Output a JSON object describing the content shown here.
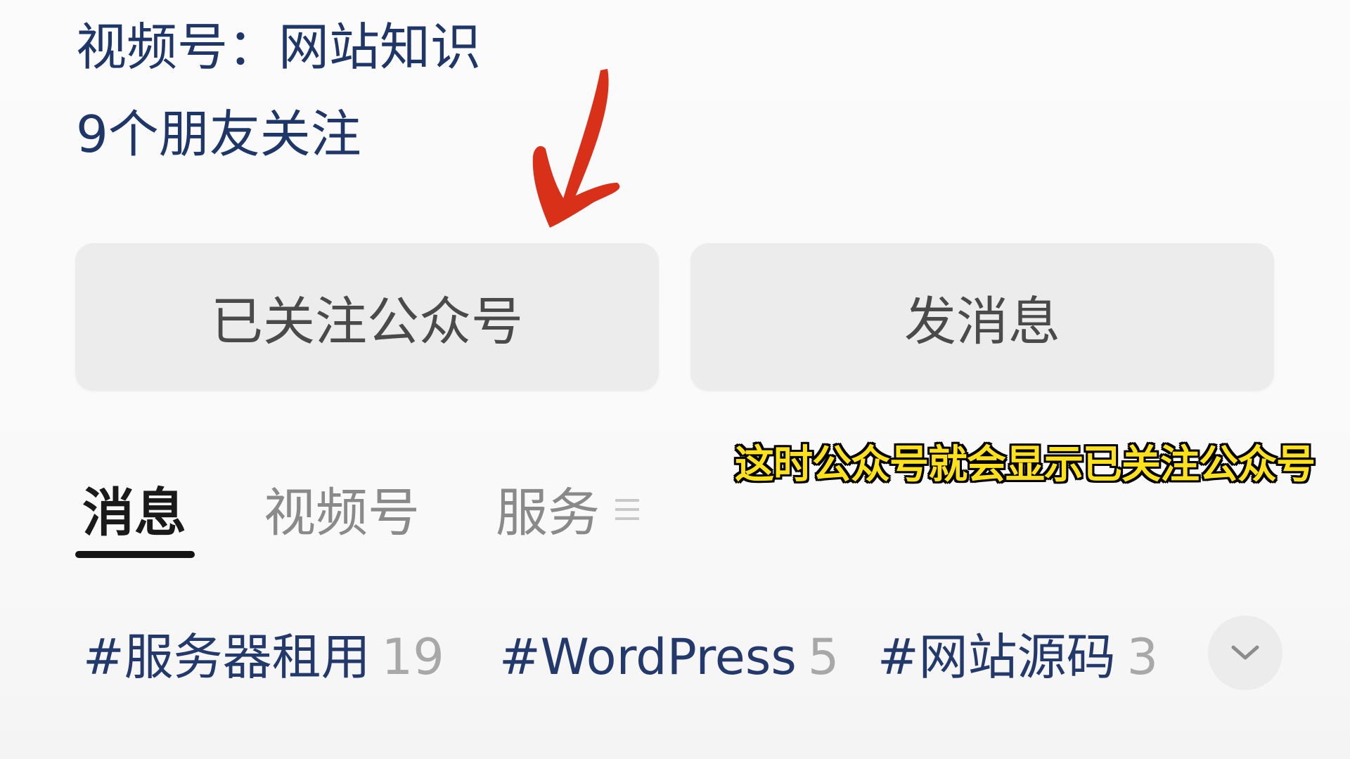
{
  "profile": {
    "channel_text": "视频号：网站知识",
    "friends_text": "9个朋友关注"
  },
  "actions": {
    "follow_label": "已关注公众号",
    "message_label": "发消息"
  },
  "caption": {
    "text": "这时公众号就会显示已关注公众号"
  },
  "tabs": {
    "items": [
      {
        "label": "消息",
        "active": true
      },
      {
        "label": "视频号",
        "active": false
      },
      {
        "label": "服务",
        "active": false
      }
    ],
    "menu_icon": "menu-lines-icon"
  },
  "hashtags": [
    {
      "name": "#服务器租用",
      "count": "19"
    },
    {
      "name": "#WordPress",
      "count": "5"
    },
    {
      "name": "#网站源码",
      "count": "3"
    }
  ],
  "icons": {
    "annotation_arrow": "red-arrow-icon",
    "expand": "chevron-down-icon"
  },
  "colors": {
    "link_text": "#1f3668",
    "button_bg": "#ececec",
    "caption_text": "#ffe11a",
    "arrow": "#d9301a",
    "active_tab": "#141414"
  }
}
